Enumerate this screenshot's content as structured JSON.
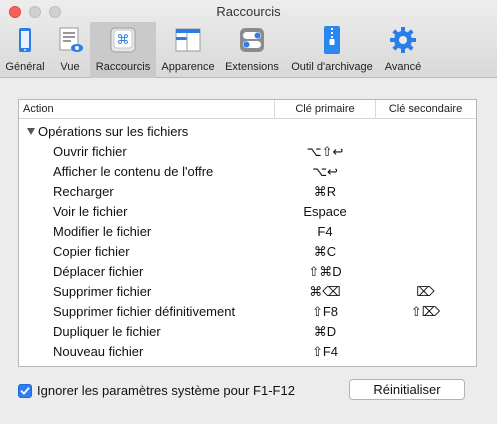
{
  "window": {
    "title": "Raccourcis"
  },
  "toolbar": {
    "tabs": [
      {
        "label": "Général",
        "icon": "phone-device-icon"
      },
      {
        "label": "Vue",
        "icon": "list-eye-icon"
      },
      {
        "label": "Raccourcis",
        "icon": "command-key-icon",
        "active": true
      },
      {
        "label": "Apparence",
        "icon": "window-layout-icon"
      },
      {
        "label": "Extensions",
        "icon": "toggle-switches-icon"
      },
      {
        "label": "Outil d'archivage",
        "icon": "zip-archive-icon"
      },
      {
        "label": "Avancé",
        "icon": "gear-icon"
      }
    ]
  },
  "table": {
    "columns": {
      "action": "Action",
      "primary": "Clé primaire",
      "secondary": "Clé secondaire"
    },
    "group": "Opérations sur les fichiers",
    "rows": [
      {
        "action": "Ouvrir fichier",
        "primary": "⌥⇧↩",
        "secondary": ""
      },
      {
        "action": "Afficher le contenu de l'offre",
        "primary": "⌥↩",
        "secondary": ""
      },
      {
        "action": "Recharger",
        "primary": "⌘R",
        "secondary": ""
      },
      {
        "action": "Voir le fichier",
        "primary": "Espace",
        "secondary": ""
      },
      {
        "action": "Modifier le fichier",
        "primary": "F4",
        "secondary": ""
      },
      {
        "action": "Copier fichier",
        "primary": "⌘C",
        "secondary": ""
      },
      {
        "action": "Déplacer fichier",
        "primary": "⇧⌘D",
        "secondary": ""
      },
      {
        "action": "Supprimer fichier",
        "primary": "⌘⌫",
        "secondary": "⌦"
      },
      {
        "action": "Supprimer fichier définitivement",
        "primary": "⇧F8",
        "secondary": "⇧⌦"
      },
      {
        "action": "Dupliquer le fichier",
        "primary": "⌘D",
        "secondary": ""
      },
      {
        "action": "Nouveau fichier",
        "primary": "⇧F4",
        "secondary": ""
      }
    ]
  },
  "footer": {
    "checkbox_label": "Ignorer les paramètres système pour F1-F12",
    "checkbox_checked": true,
    "reset_label": "Réinitialiser"
  },
  "colors": {
    "accent": "#2e7cf6",
    "close": "#fc5f57",
    "active_tab_bg": "#cacaca"
  }
}
